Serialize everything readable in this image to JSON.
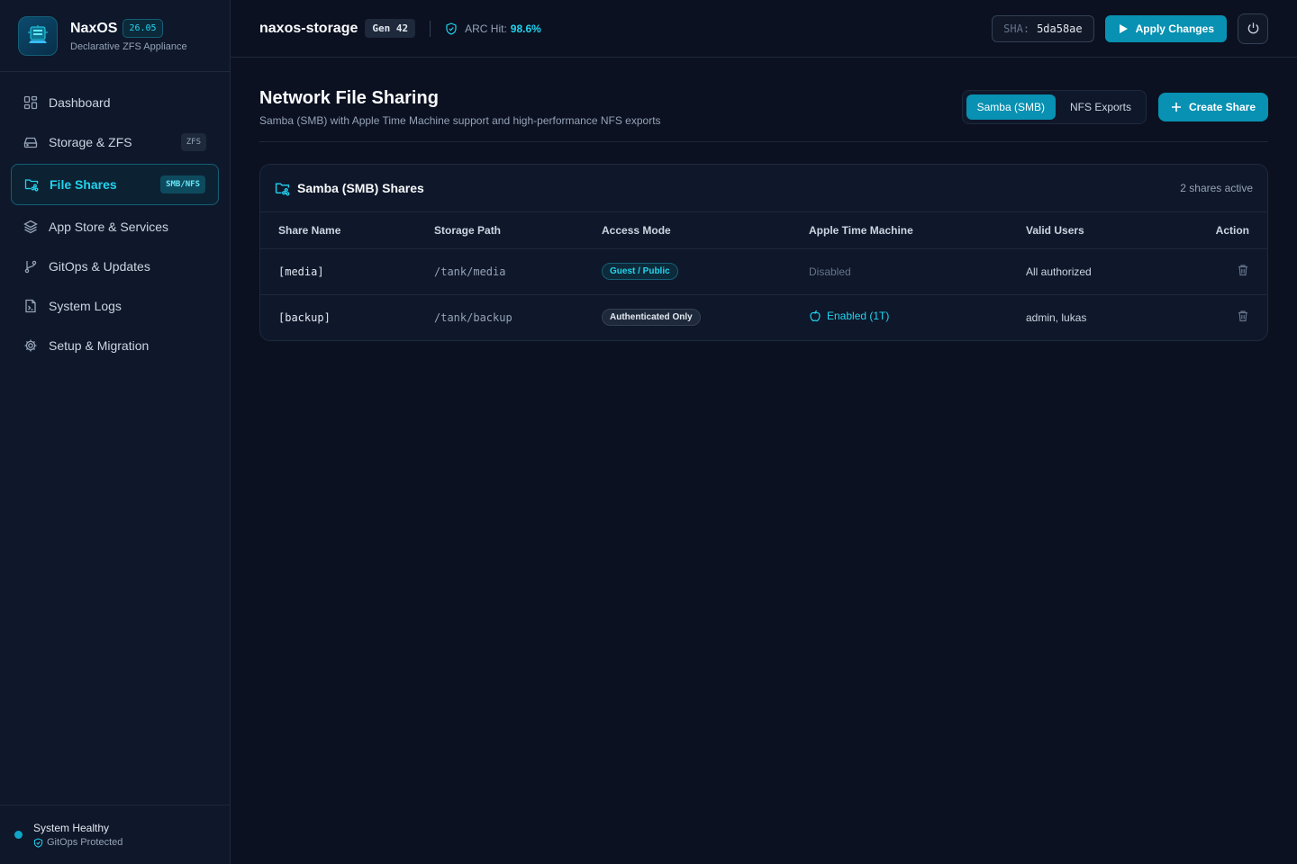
{
  "brand": {
    "name": "NaxOS",
    "version": "26.05",
    "subtitle": "Declarative ZFS Appliance"
  },
  "sidebar": {
    "items": [
      {
        "label": "Dashboard",
        "icon": "dashboard-icon"
      },
      {
        "label": "Storage & ZFS",
        "icon": "hard-drive-icon",
        "badge": "ZFS"
      },
      {
        "label": "File Shares",
        "icon": "folder-share-icon",
        "badge": "SMB/NFS",
        "active": true
      },
      {
        "label": "App Store & Services",
        "icon": "layers-icon"
      },
      {
        "label": "GitOps & Updates",
        "icon": "git-branch-icon"
      },
      {
        "label": "System Logs",
        "icon": "file-terminal-icon"
      },
      {
        "label": "Setup & Migration",
        "icon": "gear-icon"
      }
    ],
    "status": {
      "title": "System Healthy",
      "subtitle": "GitOps Protected"
    }
  },
  "topbar": {
    "hostname": "naxos-storage",
    "generation": "Gen 42",
    "arc_label": "ARC Hit:",
    "arc_value": "98.6%",
    "sha_label": "SHA:",
    "sha_value": "5da58ae",
    "apply_label": "Apply Changes"
  },
  "page": {
    "title": "Network File Sharing",
    "subtitle": "Samba (SMB) with Apple Time Machine support and high-performance NFS exports",
    "tabs": [
      {
        "label": "Samba (SMB)",
        "active": true
      },
      {
        "label": "NFS Exports",
        "active": false
      }
    ],
    "create_label": "Create Share"
  },
  "shares_card": {
    "title": "Samba (SMB) Shares",
    "count": "2 shares active",
    "columns": [
      "Share Name",
      "Storage Path",
      "Access Mode",
      "Apple Time Machine",
      "Valid Users",
      "Action"
    ],
    "rows": [
      {
        "name": "[media]",
        "path": "/tank/media",
        "access": "Guest / Public",
        "time_machine": "Disabled",
        "users": "All authorized"
      },
      {
        "name": "[backup]",
        "path": "/tank/backup",
        "access": "Authenticated Only",
        "time_machine": "Enabled (1T)",
        "users": "admin, lukas"
      }
    ]
  },
  "colors": {
    "accent": "#0891b2",
    "accent_text": "#22d3ee",
    "background": "#0b1120",
    "panel": "#0f172a"
  }
}
